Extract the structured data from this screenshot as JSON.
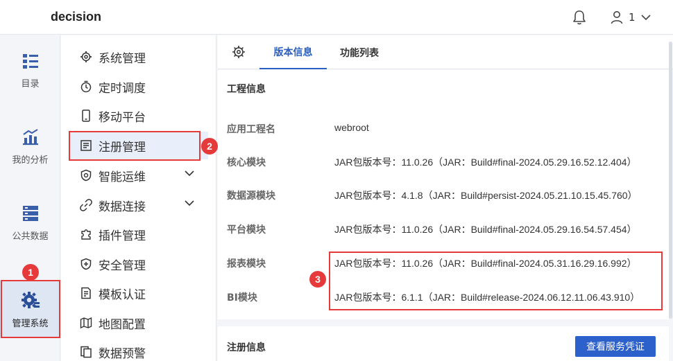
{
  "header": {
    "brand": "decision",
    "user_name": "1",
    "icons": {
      "bell": "bell-icon",
      "user": "user-icon",
      "dropdown": "chevron-down-icon"
    }
  },
  "rail": {
    "items": [
      {
        "label": "目录",
        "icon": "catalog-icon"
      },
      {
        "label": "我的分析",
        "icon": "analysis-chart-icon"
      },
      {
        "label": "公共数据",
        "icon": "database-icon"
      },
      {
        "label": "管理系统",
        "icon": "gear-admin-icon",
        "active": true
      }
    ]
  },
  "submenu": {
    "items": [
      {
        "label": "系统管理",
        "icon": "gear-icon"
      },
      {
        "label": "定时调度",
        "icon": "timer-icon"
      },
      {
        "label": "移动平台",
        "icon": "mobile-icon"
      },
      {
        "label": "注册管理",
        "icon": "register-icon",
        "active": true
      },
      {
        "label": "智能运维",
        "icon": "ops-icon",
        "expandable": true
      },
      {
        "label": "数据连接",
        "icon": "link-icon",
        "expandable": true
      },
      {
        "label": "插件管理",
        "icon": "puzzle-icon"
      },
      {
        "label": "安全管理",
        "icon": "shield-icon"
      },
      {
        "label": "模板认证",
        "icon": "template-icon"
      },
      {
        "label": "地图配置",
        "icon": "map-icon"
      },
      {
        "label": "数据预警",
        "icon": "alert-doc-icon"
      }
    ]
  },
  "tabs": {
    "items": [
      {
        "label": "版本信息",
        "active": true
      },
      {
        "label": "功能列表",
        "active": false
      }
    ]
  },
  "project_info": {
    "title": "工程信息",
    "rows": [
      {
        "key": "应用工程名",
        "value": "webroot"
      },
      {
        "key": "核心模块",
        "value": "JAR包版本号：11.0.26（JAR：Build#final-2024.05.29.16.52.12.404）"
      },
      {
        "key": "数据源模块",
        "value": "JAR包版本号：4.1.8（JAR：Build#persist-2024.05.21.10.15.45.760）"
      },
      {
        "key": "平台模块",
        "value": "JAR包版本号：11.0.26（JAR：Build#final-2024.05.29.16.54.57.454）"
      },
      {
        "key": "报表模块",
        "value": "JAR包版本号：11.0.26（JAR：Build#final-2024.05.31.16.29.16.992）"
      },
      {
        "key": "BI模块",
        "value": "JAR包版本号：6.1.1（JAR：Build#release-2024.06.12.11.06.43.910）"
      }
    ]
  },
  "register_info": {
    "title": "注册信息",
    "button": "查看服务凭证"
  },
  "annotations": {
    "badges": [
      "1",
      "2",
      "3"
    ],
    "color": "#e63a3a"
  },
  "colors": {
    "accent": "#2a5fc2",
    "button": "#2c61cc",
    "active_bg": "#e8eefa"
  }
}
